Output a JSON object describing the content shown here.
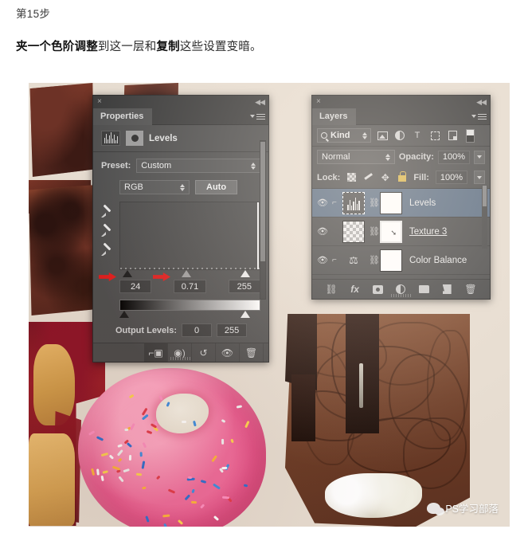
{
  "article": {
    "step_label": "第15步",
    "description_parts": [
      {
        "text": "夹一个色阶调整",
        "bold": true
      },
      {
        "text": "到这一层和",
        "bold": false
      },
      {
        "text": "复制",
        "bold": true
      },
      {
        "text": "这些设置变暗。",
        "bold": false
      }
    ]
  },
  "properties_panel": {
    "title": "Properties",
    "adjustment_name": "Levels",
    "close_icon": "×",
    "collapse_icon": "◀◀",
    "menu_icon": "panel-menu-icon",
    "preset_label": "Preset:",
    "preset_value": "Custom",
    "channel_value": "RGB",
    "auto_button": "Auto",
    "input_shadow": "24",
    "input_midtone": "0.71",
    "input_highlight": "255",
    "output_label": "Output Levels:",
    "output_shadow": "0",
    "output_highlight": "255",
    "footer_icons": [
      "clip-to-layer-icon",
      "preview-previous-state-icon",
      "reset-adjustment-icon",
      "toggle-visibility-icon",
      "delete-adjustment-icon"
    ],
    "eyedroppers": [
      "set-black-point-eyedropper",
      "set-gray-point-eyedropper",
      "set-white-point-eyedropper"
    ]
  },
  "layers_panel": {
    "title": "Layers",
    "close_icon": "×",
    "collapse_icon": "◀◀",
    "filter_label": "Kind",
    "filter_icons": [
      "filter-pixel-icon",
      "filter-adjustment-icon",
      "filter-type-icon",
      "filter-shape-icon",
      "filter-smart-object-icon",
      "filter-toggle-switch"
    ],
    "type_icon_glyph": "T",
    "blend_mode": "Normal",
    "opacity_label": "Opacity:",
    "opacity_value": "100%",
    "lock_label": "Lock:",
    "lock_icons": [
      "lock-transparent-pixels-icon",
      "lock-image-pixels-icon",
      "lock-position-icon",
      "lock-all-icon"
    ],
    "lock_move_glyph": "✥",
    "fill_label": "Fill:",
    "fill_value": "100%",
    "layers": [
      {
        "name": "Levels",
        "selected": true,
        "clipped": true,
        "thumb": "levels-adjustment-thumb",
        "underline": false
      },
      {
        "name": "Texture 3",
        "selected": false,
        "clipped": false,
        "thumb": "transparent-checker-thumb",
        "underline": true
      },
      {
        "name": "Color Balance",
        "selected": false,
        "clipped": true,
        "thumb": "color-balance-thumb",
        "underline": false
      }
    ],
    "footer_icons": [
      "link-layers-icon",
      "layer-style-fx-icon",
      "add-layer-mask-icon",
      "new-adjustment-layer-icon",
      "new-group-icon",
      "new-layer-icon",
      "delete-layer-icon"
    ],
    "fx_glyph": "fx",
    "trash_glyph": "🗑",
    "link_glyph": "⛓",
    "eye_glyph": "👁"
  },
  "annotations": {
    "arrow_color": "#e01b1b",
    "arrow_count": 2,
    "targets": [
      "input-shadow-field",
      "input-midtone-field"
    ]
  },
  "watermark": {
    "text": "PS学习部落",
    "icon": "wechat-icon"
  },
  "canvas": {
    "background_color": "#e6dcd0",
    "subjects": [
      "chocolate-brownie-slabs",
      "jam-filled-pastry",
      "pink-frosted-sprinkle-donut",
      "chocolate-drizzle-dessert"
    ]
  }
}
